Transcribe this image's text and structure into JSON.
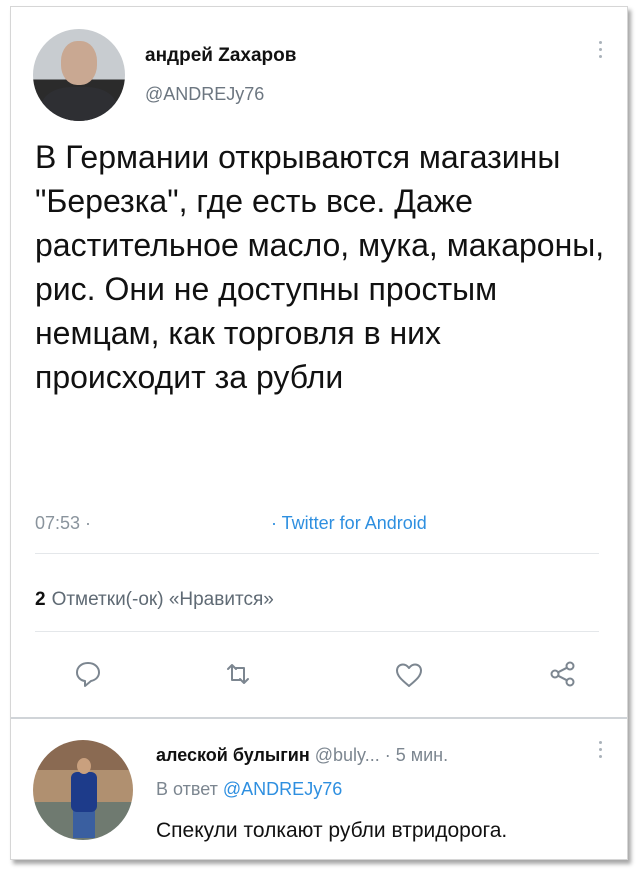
{
  "tweet": {
    "author_name": "андрей Zахаров",
    "author_handle": "@ANDREJy76",
    "text": "В Германии открываются магазины \"Березка\", где есть все. Даже растительное масло, мука, макароны, рис. Они не доступны простым немцам, как торговля в них происходит за рубли",
    "time": "07:53 ·",
    "source": "· Twitter for Android",
    "likes_count": "2",
    "likes_label": "Отметки(-ок) «Нравится»"
  },
  "actions": {
    "icons": [
      "reply-icon",
      "retweet-icon",
      "like-icon",
      "share-icon"
    ]
  },
  "reply": {
    "author_name": "алеской булыгин",
    "author_handle": "@buly...",
    "time": "· 5 мин.",
    "reply_to_prefix": "В ответ",
    "reply_to_handle": "@ANDREJy76",
    "text": "Спекули толкают рубли втридорога."
  },
  "colors": {
    "link": "#2e8fe0",
    "secondary_text": "#8a949d",
    "divider": "#e4e7ea"
  }
}
